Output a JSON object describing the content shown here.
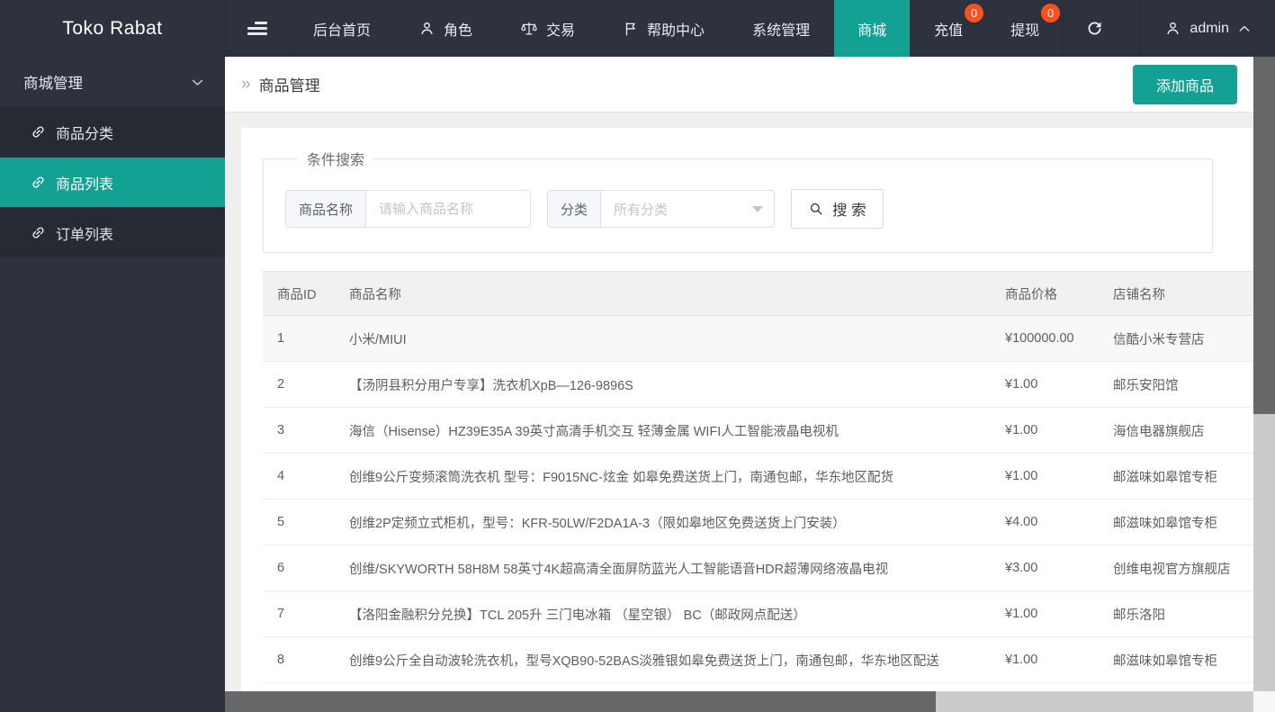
{
  "brand": {
    "name": "Toko Rabat"
  },
  "topnav": {
    "items": [
      {
        "label": "后台首页"
      },
      {
        "label": "角色",
        "icon": "user-icon"
      },
      {
        "label": "交易",
        "icon": "scales-icon"
      },
      {
        "label": "帮助中心",
        "icon": "flag-icon"
      },
      {
        "label": "系统管理"
      },
      {
        "label": "商城",
        "active": true
      },
      {
        "label": "充值",
        "badge": "0"
      },
      {
        "label": "提现",
        "badge": "0"
      }
    ],
    "user": {
      "name": "admin"
    }
  },
  "sidebar": {
    "group": {
      "label": "商城管理"
    },
    "items": [
      {
        "label": "商品分类"
      },
      {
        "label": "商品列表",
        "active": true
      },
      {
        "label": "订单列表"
      }
    ]
  },
  "page": {
    "breadcrumb": "商品管理",
    "add_button": "添加商品"
  },
  "search": {
    "legend": "条件搜索",
    "name_label": "商品名称",
    "name_placeholder": "请输入商品名称",
    "name_value": "",
    "category_label": "分类",
    "category_value": "所有分类",
    "button": "搜 索"
  },
  "table": {
    "columns": [
      "商品ID",
      "商品名称",
      "商品价格",
      "店铺名称"
    ],
    "rows": [
      {
        "id": "1",
        "name": "小米/MIUI",
        "price": "¥100000.00",
        "store": "信酷小米专营店",
        "highlighted": true
      },
      {
        "id": "2",
        "name": "【汤阴县积分用户专享】洗衣机XpB—126-9896S",
        "price": "¥1.00",
        "store": "邮乐安阳馆"
      },
      {
        "id": "3",
        "name": "海信（Hisense）HZ39E35A 39英寸高清手机交互 轻薄金属 WIFI人工智能液晶电视机",
        "price": "¥1.00",
        "store": "海信电器旗舰店"
      },
      {
        "id": "4",
        "name": "创维9公斤变频滚筒洗衣机 型号：F9015NC-炫金 如皋免费送货上门，南通包邮，华东地区配货",
        "price": "¥1.00",
        "store": "邮滋味如皋馆专柜"
      },
      {
        "id": "5",
        "name": "创维2P定频立式柜机，型号：KFR-50LW/F2DA1A-3（限如皋地区免费送货上门安装）",
        "price": "¥4.00",
        "store": "邮滋味如皋馆专柜"
      },
      {
        "id": "6",
        "name": "创维/SKYWORTH 58H8M 58英寸4K超高清全面屏防蓝光人工智能语音HDR超薄网络液晶电视",
        "price": "¥3.00",
        "store": "创维电视官方旗舰店"
      },
      {
        "id": "7",
        "name": "【洛阳金融积分兑换】TCL 205升 三门电冰箱 （星空银） BC（邮政网点配送）",
        "price": "¥1.00",
        "store": "邮乐洛阳"
      },
      {
        "id": "8",
        "name": "创维9公斤全自动波轮洗衣机，型号XQB90-52BAS淡雅银如皋免费送货上门，南通包邮，华东地区配送",
        "price": "¥1.00",
        "store": "邮滋味如皋馆专柜"
      }
    ]
  },
  "colors": {
    "topbar_bg": "#2d323e",
    "submenu_bg": "#252a33",
    "accent_teal": "#12a193",
    "badge_orange": "#ff501f",
    "page_bg": "#efefef",
    "scroll_thumb": "#666769",
    "scroll_track": "#cbcbcb"
  }
}
